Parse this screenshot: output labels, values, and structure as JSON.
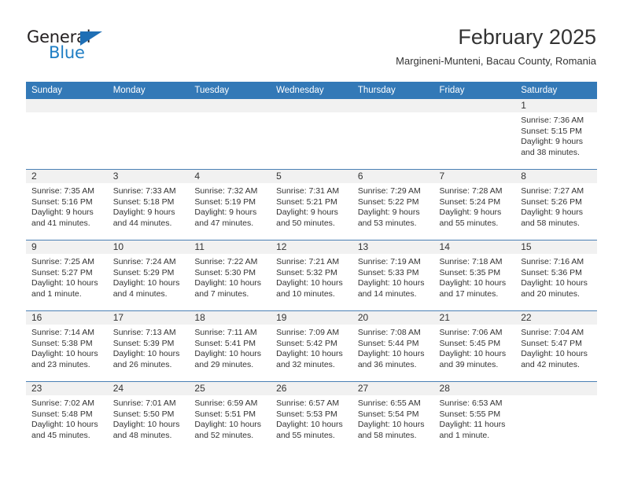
{
  "brand": {
    "name_top": "General",
    "name_bottom": "Blue",
    "accent_color": "#1f7ec4",
    "triangle_color": "#1f6fb5"
  },
  "header": {
    "month_title": "February 2025",
    "location": "Margineni-Munteni, Bacau County, Romania"
  },
  "calendar": {
    "header_bg": "#3379b7",
    "daynum_bg": "#f1f1f1",
    "row_line": "#4a80b4",
    "weekday_labels": [
      "Sunday",
      "Monday",
      "Tuesday",
      "Wednesday",
      "Thursday",
      "Friday",
      "Saturday"
    ],
    "weeks": [
      [
        {
          "day": "",
          "sunrise": "",
          "sunset": "",
          "daylight": "",
          "empty": true
        },
        {
          "day": "",
          "sunrise": "",
          "sunset": "",
          "daylight": "",
          "empty": true
        },
        {
          "day": "",
          "sunrise": "",
          "sunset": "",
          "daylight": "",
          "empty": true
        },
        {
          "day": "",
          "sunrise": "",
          "sunset": "",
          "daylight": "",
          "empty": true
        },
        {
          "day": "",
          "sunrise": "",
          "sunset": "",
          "daylight": "",
          "empty": true
        },
        {
          "day": "",
          "sunrise": "",
          "sunset": "",
          "daylight": "",
          "empty": true
        },
        {
          "day": "1",
          "sunrise": "Sunrise: 7:36 AM",
          "sunset": "Sunset: 5:15 PM",
          "daylight": "Daylight: 9 hours and 38 minutes.",
          "empty": false
        }
      ],
      [
        {
          "day": "2",
          "sunrise": "Sunrise: 7:35 AM",
          "sunset": "Sunset: 5:16 PM",
          "daylight": "Daylight: 9 hours and 41 minutes.",
          "empty": false
        },
        {
          "day": "3",
          "sunrise": "Sunrise: 7:33 AM",
          "sunset": "Sunset: 5:18 PM",
          "daylight": "Daylight: 9 hours and 44 minutes.",
          "empty": false
        },
        {
          "day": "4",
          "sunrise": "Sunrise: 7:32 AM",
          "sunset": "Sunset: 5:19 PM",
          "daylight": "Daylight: 9 hours and 47 minutes.",
          "empty": false
        },
        {
          "day": "5",
          "sunrise": "Sunrise: 7:31 AM",
          "sunset": "Sunset: 5:21 PM",
          "daylight": "Daylight: 9 hours and 50 minutes.",
          "empty": false
        },
        {
          "day": "6",
          "sunrise": "Sunrise: 7:29 AM",
          "sunset": "Sunset: 5:22 PM",
          "daylight": "Daylight: 9 hours and 53 minutes.",
          "empty": false
        },
        {
          "day": "7",
          "sunrise": "Sunrise: 7:28 AM",
          "sunset": "Sunset: 5:24 PM",
          "daylight": "Daylight: 9 hours and 55 minutes.",
          "empty": false
        },
        {
          "day": "8",
          "sunrise": "Sunrise: 7:27 AM",
          "sunset": "Sunset: 5:26 PM",
          "daylight": "Daylight: 9 hours and 58 minutes.",
          "empty": false
        }
      ],
      [
        {
          "day": "9",
          "sunrise": "Sunrise: 7:25 AM",
          "sunset": "Sunset: 5:27 PM",
          "daylight": "Daylight: 10 hours and 1 minute.",
          "empty": false
        },
        {
          "day": "10",
          "sunrise": "Sunrise: 7:24 AM",
          "sunset": "Sunset: 5:29 PM",
          "daylight": "Daylight: 10 hours and 4 minutes.",
          "empty": false
        },
        {
          "day": "11",
          "sunrise": "Sunrise: 7:22 AM",
          "sunset": "Sunset: 5:30 PM",
          "daylight": "Daylight: 10 hours and 7 minutes.",
          "empty": false
        },
        {
          "day": "12",
          "sunrise": "Sunrise: 7:21 AM",
          "sunset": "Sunset: 5:32 PM",
          "daylight": "Daylight: 10 hours and 10 minutes.",
          "empty": false
        },
        {
          "day": "13",
          "sunrise": "Sunrise: 7:19 AM",
          "sunset": "Sunset: 5:33 PM",
          "daylight": "Daylight: 10 hours and 14 minutes.",
          "empty": false
        },
        {
          "day": "14",
          "sunrise": "Sunrise: 7:18 AM",
          "sunset": "Sunset: 5:35 PM",
          "daylight": "Daylight: 10 hours and 17 minutes.",
          "empty": false
        },
        {
          "day": "15",
          "sunrise": "Sunrise: 7:16 AM",
          "sunset": "Sunset: 5:36 PM",
          "daylight": "Daylight: 10 hours and 20 minutes.",
          "empty": false
        }
      ],
      [
        {
          "day": "16",
          "sunrise": "Sunrise: 7:14 AM",
          "sunset": "Sunset: 5:38 PM",
          "daylight": "Daylight: 10 hours and 23 minutes.",
          "empty": false
        },
        {
          "day": "17",
          "sunrise": "Sunrise: 7:13 AM",
          "sunset": "Sunset: 5:39 PM",
          "daylight": "Daylight: 10 hours and 26 minutes.",
          "empty": false
        },
        {
          "day": "18",
          "sunrise": "Sunrise: 7:11 AM",
          "sunset": "Sunset: 5:41 PM",
          "daylight": "Daylight: 10 hours and 29 minutes.",
          "empty": false
        },
        {
          "day": "19",
          "sunrise": "Sunrise: 7:09 AM",
          "sunset": "Sunset: 5:42 PM",
          "daylight": "Daylight: 10 hours and 32 minutes.",
          "empty": false
        },
        {
          "day": "20",
          "sunrise": "Sunrise: 7:08 AM",
          "sunset": "Sunset: 5:44 PM",
          "daylight": "Daylight: 10 hours and 36 minutes.",
          "empty": false
        },
        {
          "day": "21",
          "sunrise": "Sunrise: 7:06 AM",
          "sunset": "Sunset: 5:45 PM",
          "daylight": "Daylight: 10 hours and 39 minutes.",
          "empty": false
        },
        {
          "day": "22",
          "sunrise": "Sunrise: 7:04 AM",
          "sunset": "Sunset: 5:47 PM",
          "daylight": "Daylight: 10 hours and 42 minutes.",
          "empty": false
        }
      ],
      [
        {
          "day": "23",
          "sunrise": "Sunrise: 7:02 AM",
          "sunset": "Sunset: 5:48 PM",
          "daylight": "Daylight: 10 hours and 45 minutes.",
          "empty": false
        },
        {
          "day": "24",
          "sunrise": "Sunrise: 7:01 AM",
          "sunset": "Sunset: 5:50 PM",
          "daylight": "Daylight: 10 hours and 48 minutes.",
          "empty": false
        },
        {
          "day": "25",
          "sunrise": "Sunrise: 6:59 AM",
          "sunset": "Sunset: 5:51 PM",
          "daylight": "Daylight: 10 hours and 52 minutes.",
          "empty": false
        },
        {
          "day": "26",
          "sunrise": "Sunrise: 6:57 AM",
          "sunset": "Sunset: 5:53 PM",
          "daylight": "Daylight: 10 hours and 55 minutes.",
          "empty": false
        },
        {
          "day": "27",
          "sunrise": "Sunrise: 6:55 AM",
          "sunset": "Sunset: 5:54 PM",
          "daylight": "Daylight: 10 hours and 58 minutes.",
          "empty": false
        },
        {
          "day": "28",
          "sunrise": "Sunrise: 6:53 AM",
          "sunset": "Sunset: 5:55 PM",
          "daylight": "Daylight: 11 hours and 1 minute.",
          "empty": false
        },
        {
          "day": "",
          "sunrise": "",
          "sunset": "",
          "daylight": "",
          "empty": true
        }
      ]
    ]
  }
}
